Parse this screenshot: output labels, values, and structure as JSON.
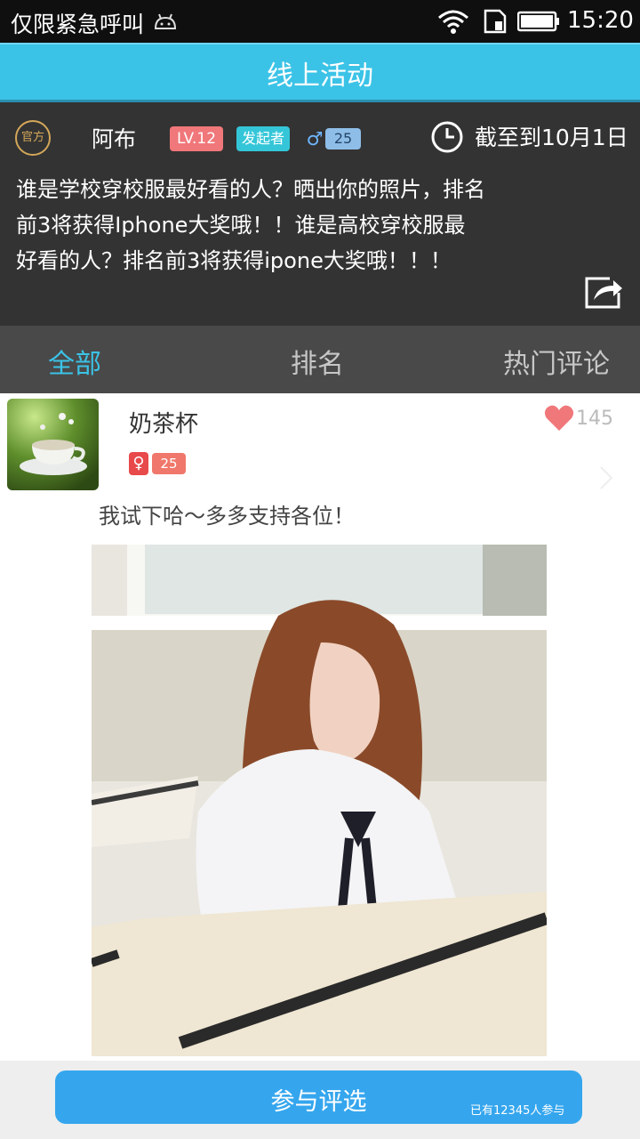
{
  "status_bar": {
    "carrier": "仅限紧急呼叫",
    "time": "15:20",
    "icons": [
      "android-icon",
      "wifi-icon",
      "sim-icon",
      "battery-icon"
    ]
  },
  "titlebar": {
    "title": "线上活动"
  },
  "activity": {
    "official_badge": "官方",
    "author": "阿布",
    "level": "LV.12",
    "initiator_badge": "发起者",
    "gender_symbol": "♂",
    "age": "25",
    "deadline": "截至到10月1日",
    "description_lines": [
      "谁是学校穿校服最好看的人？晒出你的照片，排名",
      "前3将获得Iphone大奖哦！！谁是高校穿校服最",
      "好看的人？排名前3将获得ipone大奖哦！！！"
    ]
  },
  "tabs": [
    {
      "label": "全部",
      "active": true
    },
    {
      "label": "排名",
      "active": false
    },
    {
      "label": "热门评论",
      "active": false
    }
  ],
  "post": {
    "username": "奶茶杯",
    "gender_symbol": "♀",
    "age": "25",
    "likes": "145",
    "text": "我试下哈～多多支持各位！"
  },
  "join": {
    "label": "参与评选",
    "participants": "已有12345人参与"
  },
  "colors": {
    "accent": "#3bc3e7",
    "header_bg": "#333333",
    "button": "#35a6ee",
    "heart": "#f0777a"
  }
}
